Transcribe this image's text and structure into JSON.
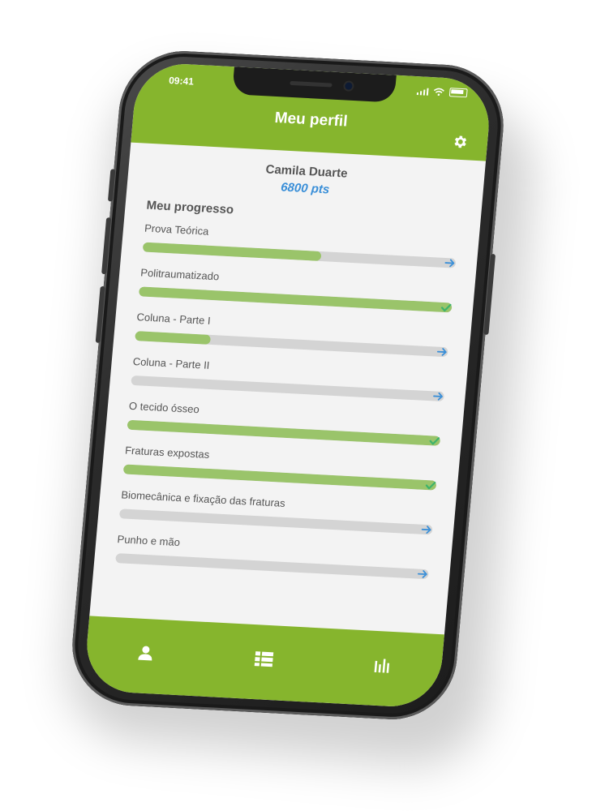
{
  "status_bar": {
    "time": "09:41"
  },
  "header": {
    "title": "Meu perfil"
  },
  "profile": {
    "name": "Camila Duarte",
    "points": "6800 pts"
  },
  "progress": {
    "title": "Meu progresso",
    "items": [
      {
        "label": "Prova Teórica",
        "progress_pct": 57,
        "status": "arrow"
      },
      {
        "label": "Politraumatizado",
        "progress_pct": 100,
        "status": "check"
      },
      {
        "label": "Coluna - Parte I",
        "progress_pct": 24,
        "status": "arrow"
      },
      {
        "label": "Coluna - Parte II",
        "progress_pct": 0,
        "status": "arrow"
      },
      {
        "label": "O tecido ósseo",
        "progress_pct": 100,
        "status": "check"
      },
      {
        "label": "Fraturas expostas",
        "progress_pct": 100,
        "status": "check"
      },
      {
        "label": "Biomecânica e fixação das fraturas",
        "progress_pct": 0,
        "status": "arrow"
      },
      {
        "label": "Punho e mão",
        "progress_pct": 0,
        "status": "arrow"
      }
    ]
  },
  "tabs": [
    {
      "icon": "user-icon"
    },
    {
      "icon": "list-icon"
    },
    {
      "icon": "bar-chart-icon"
    }
  ],
  "colors": {
    "brand_green": "#86b52d",
    "progress_fill": "#9ac46a",
    "progress_track": "#d4d4d4",
    "points_blue": "#3a8fd8",
    "check_green": "#3db36b",
    "arrow_blue": "#3a8fd8"
  }
}
